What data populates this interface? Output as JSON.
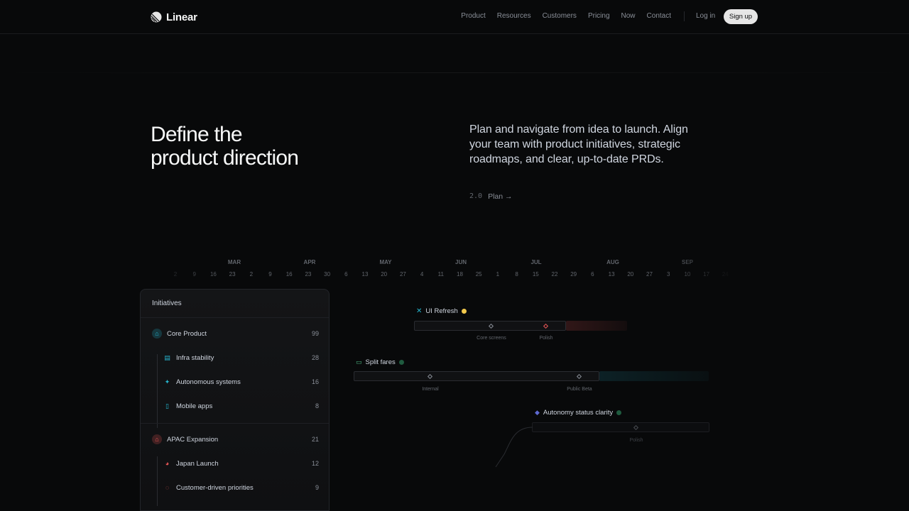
{
  "brand": {
    "name": "Linear"
  },
  "nav": {
    "items": [
      "Product",
      "Resources",
      "Customers",
      "Pricing",
      "Now",
      "Contact"
    ],
    "login": "Log in",
    "signup": "Sign up"
  },
  "hero": {
    "title_line1": "Define the",
    "title_line2": "product direction",
    "description": "Plan and navigate from idea to launch. Align your team with product initiatives, strategic roadmaps, and clear, up-to-date PRDs.",
    "version": "2.0",
    "link_label": "Plan",
    "link_arrow": "→"
  },
  "timeline": {
    "months": [
      "MAR",
      "APR",
      "MAY",
      "JUN",
      "JUL",
      "AUG",
      "SEP"
    ],
    "days": [
      "2",
      "9",
      "16",
      "23",
      "2",
      "9",
      "16",
      "23",
      "30",
      "6",
      "13",
      "20",
      "27",
      "4",
      "11",
      "18",
      "25",
      "1",
      "8",
      "15",
      "22",
      "29",
      "6",
      "13",
      "20",
      "27",
      "3",
      "10",
      "17",
      "24",
      "1"
    ]
  },
  "initiatives": {
    "header": "Initiatives",
    "groups": [
      {
        "name": "Core Product",
        "count": "99",
        "icon": "core-product-icon",
        "color": "#26b5ce",
        "children": [
          {
            "name": "Infra stability",
            "count": "28",
            "icon": "infra-icon",
            "color": "#26b5ce"
          },
          {
            "name": "Autonomous systems",
            "count": "16",
            "icon": "sparkle-icon",
            "color": "#26b5ce"
          },
          {
            "name": "Mobile apps",
            "count": "8",
            "icon": "mobile-icon",
            "color": "#26b5ce"
          }
        ]
      },
      {
        "name": "APAC Expansion",
        "count": "21",
        "icon": "apac-icon",
        "color": "#eb5757",
        "children": [
          {
            "name": "Japan Launch",
            "count": "12",
            "icon": "japan-icon",
            "color": "#eb5757"
          },
          {
            "name": "Customer-driven priorities",
            "count": "9",
            "icon": "chat-icon",
            "color": "#eb5757"
          }
        ]
      }
    ]
  },
  "projects": {
    "ui_refresh": {
      "name": "UI Refresh",
      "milestones": [
        "Core screens",
        "Polish"
      ]
    },
    "split_fares": {
      "name": "Split fares",
      "milestones": [
        "Internal",
        "Public Beta"
      ]
    },
    "autonomy": {
      "name": "Autonomy status clarity",
      "milestones": [
        "Polish"
      ]
    }
  },
  "colors": {
    "accent_red": "#eb5757",
    "accent_teal": "#26b5ce",
    "accent_yellow": "#f2c94c",
    "accent_green": "#4cb782"
  }
}
